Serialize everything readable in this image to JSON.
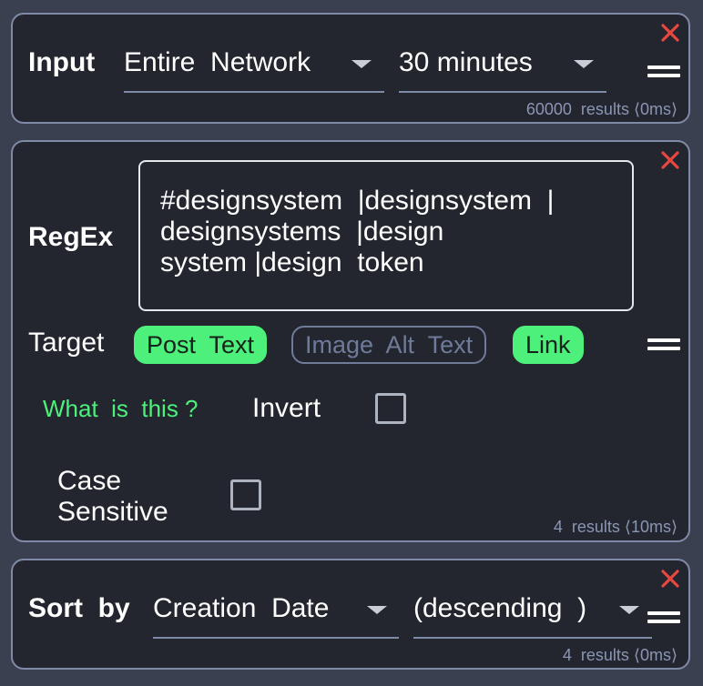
{
  "input_panel": {
    "label": "Input",
    "scope_value": "Entire  Network",
    "time_value": "30 minutes",
    "results": "60000  results ⟨0ms⟩",
    "close_icon": "close-icon",
    "drag_icon": "drag-handle-icon"
  },
  "regex_panel": {
    "label": "RegEx",
    "pattern": "#designsystem  |designsystem  |\ndesignsystems  |design\nsystem |design  token",
    "target_label": "Target",
    "targets": [
      {
        "label": "Post  Text",
        "active": true
      },
      {
        "label": "Image  Alt  Text",
        "active": false
      },
      {
        "label": "Link",
        "active": true
      }
    ],
    "help_link": "What  is  this ?",
    "invert_label": "Invert",
    "invert_checked": false,
    "case_label": "Case\nSensitive",
    "case_checked": false,
    "results": "4  results ⟨10ms⟩"
  },
  "sort_panel": {
    "label": "Sort  by",
    "field_value": "Creation  Date",
    "order_value": "(descending  )",
    "results": "4  results ⟨0ms⟩"
  },
  "colors": {
    "accent_green": "#4cf07a",
    "close_red": "#e8473f",
    "panel_bg": "#23252f",
    "page_bg": "#3b4050",
    "border": "#7f8aa6"
  }
}
